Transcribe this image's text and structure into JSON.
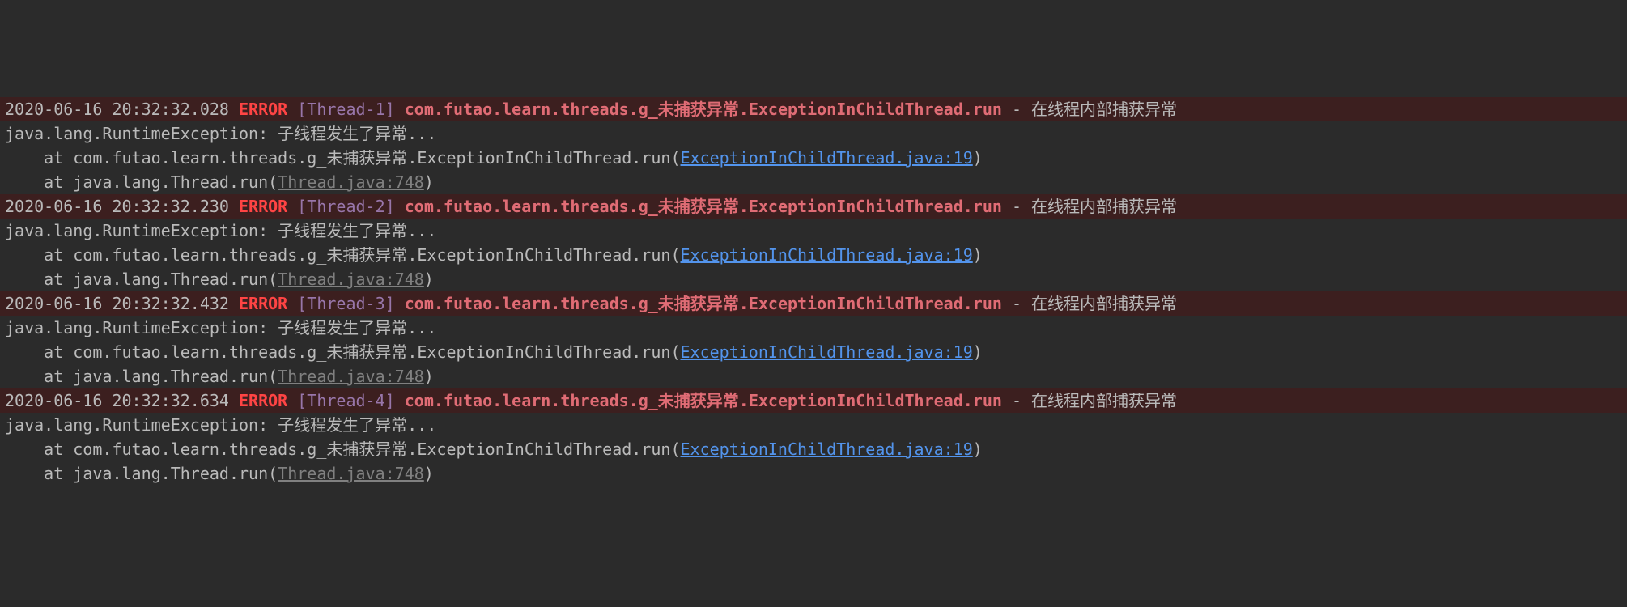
{
  "colors": {
    "bg": "#2b2b2b",
    "errorRowBg": "#3c1f1f",
    "text": "#bababa",
    "error": "#ff4444",
    "thread": "#9876aa",
    "logger": "#e06c75",
    "link": "#5394ec",
    "linkGray": "#808080"
  },
  "entries": [
    {
      "timestamp": "2020-06-16 20:32:32.028",
      "level": "ERROR",
      "thread": "[Thread-1]",
      "logger": "com.futao.learn.threads.g_未捕获异常.ExceptionInChildThread.run",
      "sep": " - ",
      "message": "在线程内部捕获异常",
      "exception": "java.lang.RuntimeException: 子线程发生了异常...",
      "stack": [
        {
          "prefix": "    at com.futao.learn.threads.g_未捕获异常.ExceptionInChildThread.run(",
          "link": "ExceptionInChildThread.java:19",
          "suffix": ")",
          "linkStyle": "link"
        },
        {
          "prefix": "    at java.lang.Thread.run(",
          "link": "Thread.java:748",
          "suffix": ")",
          "linkStyle": "link-gray"
        }
      ]
    },
    {
      "timestamp": "2020-06-16 20:32:32.230",
      "level": "ERROR",
      "thread": "[Thread-2]",
      "logger": "com.futao.learn.threads.g_未捕获异常.ExceptionInChildThread.run",
      "sep": " - ",
      "message": "在线程内部捕获异常",
      "exception": "java.lang.RuntimeException: 子线程发生了异常...",
      "stack": [
        {
          "prefix": "    at com.futao.learn.threads.g_未捕获异常.ExceptionInChildThread.run(",
          "link": "ExceptionInChildThread.java:19",
          "suffix": ")",
          "linkStyle": "link"
        },
        {
          "prefix": "    at java.lang.Thread.run(",
          "link": "Thread.java:748",
          "suffix": ")",
          "linkStyle": "link-gray"
        }
      ]
    },
    {
      "timestamp": "2020-06-16 20:32:32.432",
      "level": "ERROR",
      "thread": "[Thread-3]",
      "logger": "com.futao.learn.threads.g_未捕获异常.ExceptionInChildThread.run",
      "sep": " - ",
      "message": "在线程内部捕获异常",
      "exception": "java.lang.RuntimeException: 子线程发生了异常...",
      "stack": [
        {
          "prefix": "    at com.futao.learn.threads.g_未捕获异常.ExceptionInChildThread.run(",
          "link": "ExceptionInChildThread.java:19",
          "suffix": ")",
          "linkStyle": "link"
        },
        {
          "prefix": "    at java.lang.Thread.run(",
          "link": "Thread.java:748",
          "suffix": ")",
          "linkStyle": "link-gray"
        }
      ]
    },
    {
      "timestamp": "2020-06-16 20:32:32.634",
      "level": "ERROR",
      "thread": "[Thread-4]",
      "logger": "com.futao.learn.threads.g_未捕获异常.ExceptionInChildThread.run",
      "sep": " - ",
      "message": "在线程内部捕获异常",
      "exception": "java.lang.RuntimeException: 子线程发生了异常...",
      "stack": [
        {
          "prefix": "    at com.futao.learn.threads.g_未捕获异常.ExceptionInChildThread.run(",
          "link": "ExceptionInChildThread.java:19",
          "suffix": ")",
          "linkStyle": "link"
        },
        {
          "prefix": "    at java.lang.Thread.run(",
          "link": "Thread.java:748",
          "suffix": ")",
          "linkStyle": "link-gray"
        }
      ]
    }
  ]
}
